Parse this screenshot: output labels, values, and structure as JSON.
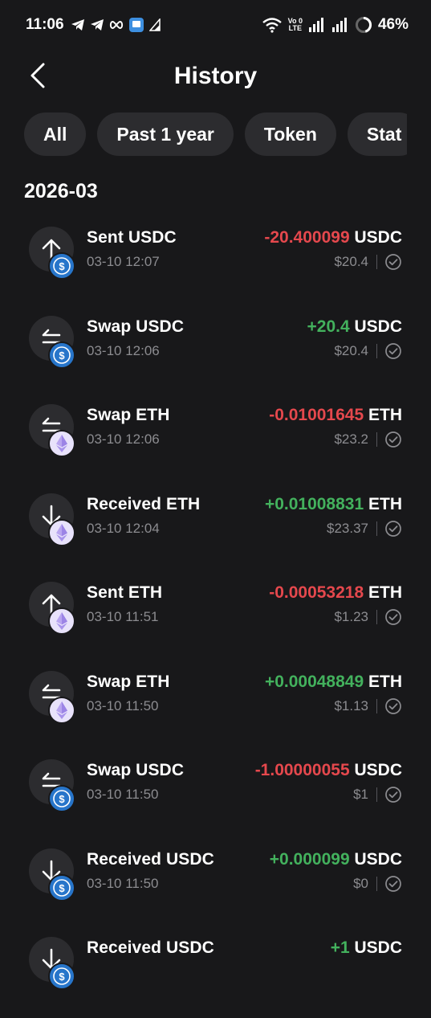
{
  "status_bar": {
    "time": "11:06",
    "network_label_top": "Vo 0",
    "network_label_bottom": "LTE",
    "battery": "46%"
  },
  "header": {
    "title": "History"
  },
  "filters": [
    "All",
    "Past 1 year",
    "Token",
    "Stat"
  ],
  "group": {
    "label": "2026-03"
  },
  "transactions": [
    {
      "title": "Sent USDC",
      "time": "03-10 12:07",
      "amount": "-20.400099",
      "unit": "USDC",
      "fiat": "$20.4",
      "dir": "up",
      "token": "usdc",
      "sign": "neg"
    },
    {
      "title": "Swap USDC",
      "time": "03-10 12:06",
      "amount": "+20.4",
      "unit": "USDC",
      "fiat": "$20.4",
      "dir": "swap",
      "token": "usdc",
      "sign": "pos"
    },
    {
      "title": "Swap ETH",
      "time": "03-10 12:06",
      "amount": "-0.01001645",
      "unit": "ETH",
      "fiat": "$23.2",
      "dir": "swap",
      "token": "eth",
      "sign": "neg"
    },
    {
      "title": "Received ETH",
      "time": "03-10 12:04",
      "amount": "+0.01008831",
      "unit": "ETH",
      "fiat": "$23.37",
      "dir": "down",
      "token": "eth",
      "sign": "pos"
    },
    {
      "title": "Sent ETH",
      "time": "03-10 11:51",
      "amount": "-0.00053218",
      "unit": "ETH",
      "fiat": "$1.23",
      "dir": "up",
      "token": "eth",
      "sign": "neg"
    },
    {
      "title": "Swap ETH",
      "time": "03-10 11:50",
      "amount": "+0.00048849",
      "unit": "ETH",
      "fiat": "$1.13",
      "dir": "swap",
      "token": "eth",
      "sign": "pos"
    },
    {
      "title": "Swap USDC",
      "time": "03-10 11:50",
      "amount": "-1.00000055",
      "unit": "USDC",
      "fiat": "$1",
      "dir": "swap",
      "token": "usdc",
      "sign": "neg"
    },
    {
      "title": "Received USDC",
      "time": "03-10 11:50",
      "amount": "+0.000099",
      "unit": "USDC",
      "fiat": "$0",
      "dir": "down",
      "token": "usdc",
      "sign": "pos"
    },
    {
      "title": "Received USDC",
      "time": "",
      "amount": "+1",
      "unit": "USDC",
      "fiat": "",
      "dir": "down",
      "token": "usdc",
      "sign": "pos"
    }
  ],
  "colors": {
    "background": "#18181a",
    "negative": "#e5484d",
    "positive": "#43b15d",
    "usdc": "#2775ca",
    "eth": "#c9b8f5"
  }
}
